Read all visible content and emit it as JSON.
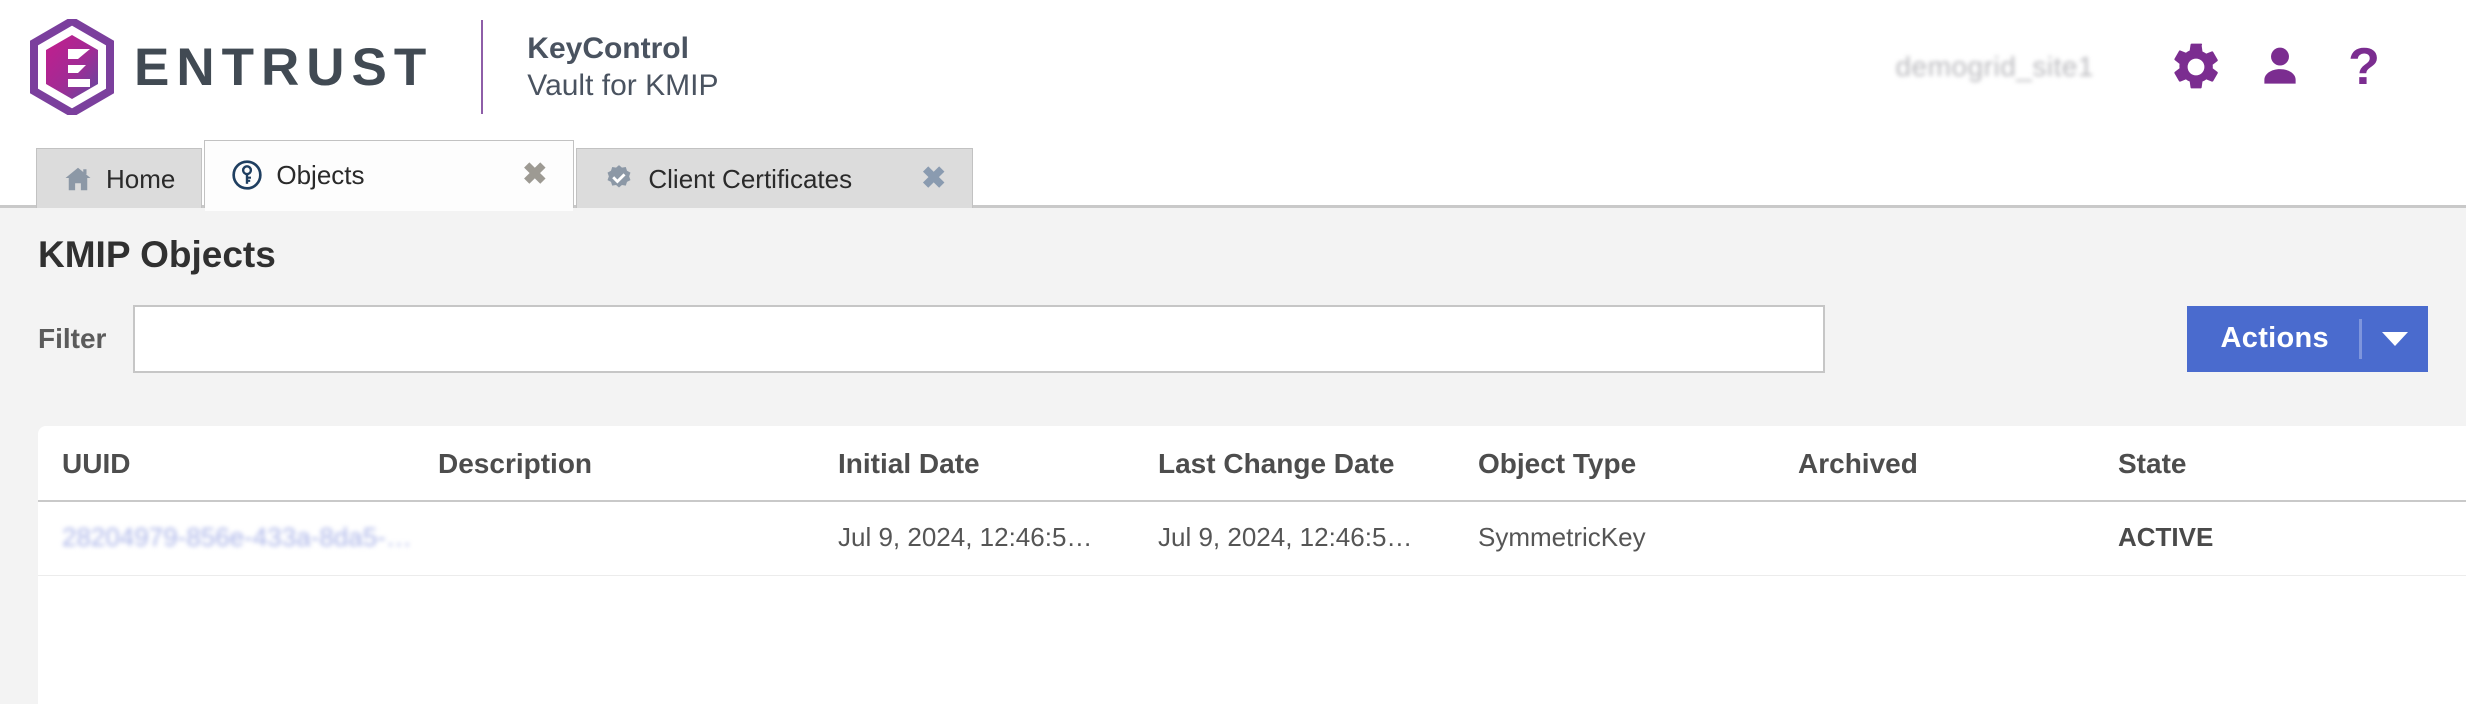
{
  "header": {
    "logo_icon": "entrust-hexagon-logo",
    "wordmark": "ENTRUST",
    "product_line_1": "KeyControl",
    "product_line_2": "Vault for KMIP",
    "site_name": "demogrid_site1",
    "settings_icon": "gear-icon",
    "user_icon": "user-icon",
    "help_icon": "question-mark-icon",
    "help_glyph": "?",
    "brand_purple": "#7b2d90",
    "logo_gradient_from": "#c8208e",
    "logo_gradient_to": "#6b3f9e"
  },
  "tabs": [
    {
      "label": "Home",
      "icon": "home-icon",
      "active": false,
      "closable": false
    },
    {
      "label": "Objects",
      "icon": "key-circle-icon",
      "active": true,
      "closable": true,
      "close_glyph": "✖"
    },
    {
      "label": "Client Certificates",
      "icon": "certificate-seal-icon",
      "active": false,
      "closable": true,
      "close_glyph": "✖"
    }
  ],
  "main": {
    "page_title": "KMIP Objects",
    "filter": {
      "label": "Filter",
      "value": "",
      "placeholder": ""
    },
    "actions": {
      "label": "Actions",
      "caret_icon": "chevron-down-icon",
      "accent_color": "#4a6bce"
    },
    "table": {
      "columns": [
        "UUID",
        "Description",
        "Initial Date",
        "Last Change Date",
        "Object Type",
        "Archived",
        "State"
      ],
      "rows": [
        {
          "uuid": "28204979-856e-433a-8da5-…",
          "description": "",
          "initial_date": "Jul 9, 2024, 12:46:5…",
          "last_change_date": "Jul 9, 2024, 12:46:5…",
          "object_type": "SymmetricKey",
          "archived": "",
          "state": "ACTIVE"
        }
      ]
    }
  }
}
